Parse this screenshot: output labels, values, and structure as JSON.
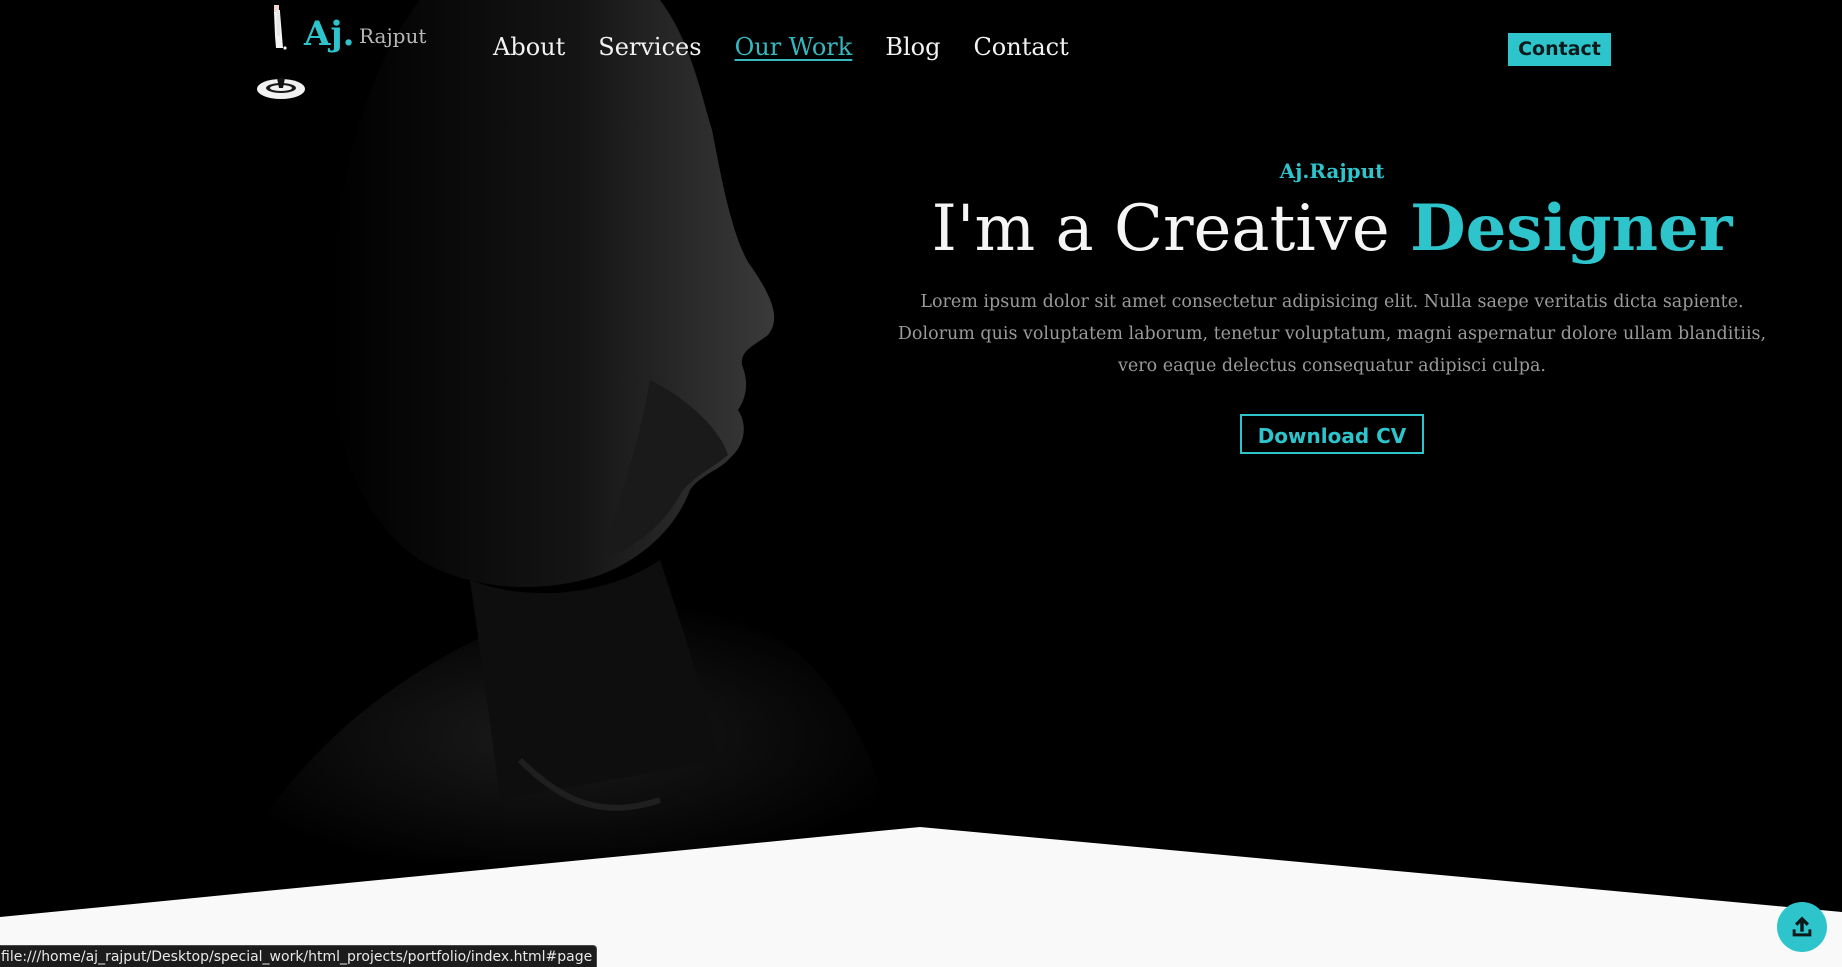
{
  "header": {
    "logo_mark": "Aj.",
    "logo_sub": "Rajput",
    "nav": [
      {
        "label": "About",
        "active": false
      },
      {
        "label": "Services",
        "active": false
      },
      {
        "label": "Our Work",
        "active": true
      },
      {
        "label": "Blog",
        "active": false
      },
      {
        "label": "Contact",
        "active": false
      }
    ],
    "contact_button": "Contact"
  },
  "hero": {
    "eyebrow": "Aj.Rajput",
    "headline_lead": "I'm a Creative",
    "headline_accent": "Designer",
    "description": "Lorem ipsum dolor sit amet consectetur adipisicing elit. Nulla saepe veritatis dicta sapiente. Dolorum quis voluptatem laborum, tenetur voluptatum, magni aspernatur dolore ullam blanditiis, vero eaque delectus consequatur adipisci culpa.",
    "cta_button": "Download CV"
  },
  "scroll_top": {
    "icon": "upload-arrow-icon"
  },
  "status_bar": {
    "url": "file:///home/aj_rajput/Desktop/special_work/html_projects/portfolio/index.html#page"
  },
  "colors": {
    "accent": "#2ec4cc",
    "background": "#000000",
    "section_bg": "#f9f9f9",
    "text_light": "#f5f5f5",
    "text_muted": "#9a9a9a"
  }
}
